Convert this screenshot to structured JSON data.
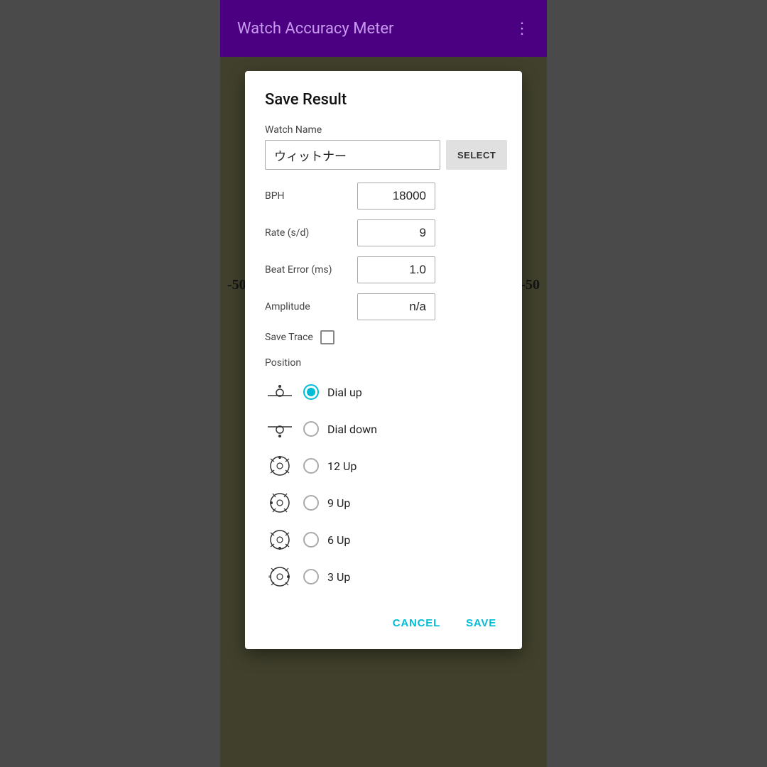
{
  "app": {
    "title": "Watch Accuracy Meter",
    "menu_icon": "⋮"
  },
  "background": {
    "left_val": "-50",
    "right_val": "-50"
  },
  "dialog": {
    "title": "Save Result",
    "watch_name_label": "Watch Name",
    "watch_name_value": "ウィットナー",
    "select_btn_label": "SELECT",
    "bph_label": "BPH",
    "bph_value": "18000",
    "rate_label": "Rate (s/d)",
    "rate_value": "9",
    "beat_error_label": "Beat Error (ms)",
    "beat_error_value": "1.0",
    "amplitude_label": "Amplitude",
    "amplitude_value": "n/a",
    "save_trace_label": "Save Trace",
    "position_label": "Position",
    "positions": [
      {
        "id": "dial_up",
        "label": "Dial up",
        "selected": true
      },
      {
        "id": "dial_down",
        "label": "Dial down",
        "selected": false
      },
      {
        "id": "12_up",
        "label": "12 Up",
        "selected": false
      },
      {
        "id": "9_up",
        "label": "9 Up",
        "selected": false
      },
      {
        "id": "6_up",
        "label": "6 Up",
        "selected": false
      },
      {
        "id": "3_up",
        "label": "3 Up",
        "selected": false
      }
    ],
    "cancel_label": "CANCEL",
    "save_label": "SAVE"
  }
}
